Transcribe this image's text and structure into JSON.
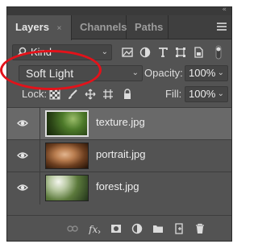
{
  "tabs": [
    {
      "label": "Layers"
    },
    {
      "label": "Channels"
    },
    {
      "label": "Paths"
    }
  ],
  "tab_close": "×",
  "collapse_glyph": "«",
  "filter": {
    "label": "Kind"
  },
  "blend_mode": {
    "value": "Soft Light"
  },
  "opacity": {
    "label": "Opacity:",
    "value": "100%"
  },
  "lock": {
    "label": "Lock:"
  },
  "fill": {
    "label": "Fill:",
    "value": "100%"
  },
  "layers": [
    {
      "name": "texture.jpg",
      "selected": true,
      "visible": true
    },
    {
      "name": "portrait.jpg",
      "selected": false,
      "visible": true
    },
    {
      "name": "forest.jpg",
      "selected": false,
      "visible": true
    }
  ],
  "colors": {
    "panel_bg": "#535353",
    "selected_row": "#696969",
    "annotation_ring": "#e3121a"
  }
}
